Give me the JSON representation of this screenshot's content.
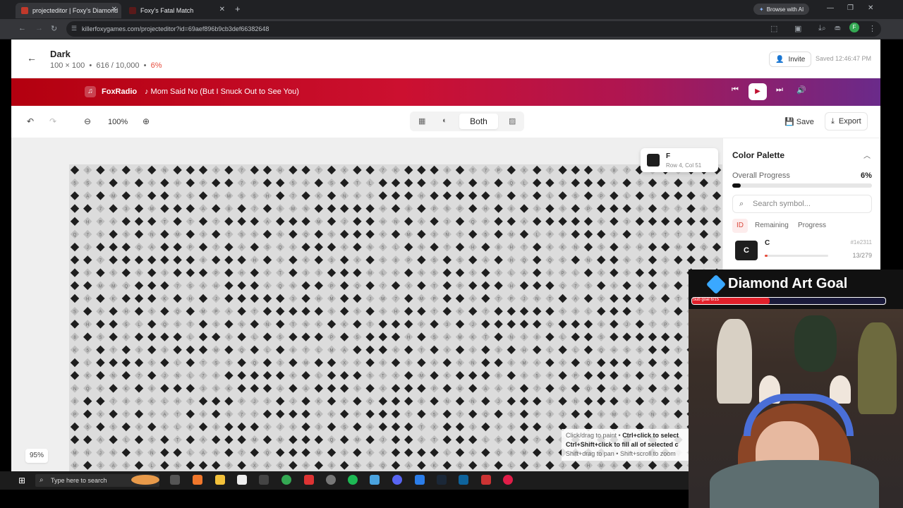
{
  "browser": {
    "tabs": [
      {
        "title": "projecteditor | Foxy's Diamond"
      },
      {
        "title": "Foxy's Fatal Match"
      }
    ],
    "ai_button": "Browse with AI",
    "url": "killerfoxygames.com/projecteditor?id=69aef896b9cb3def66382648",
    "profile_initial": "F"
  },
  "project": {
    "title": "Dark",
    "dimensions": "100 × 100",
    "separator": "•",
    "placed": "616 / 10,000",
    "percent": "6%",
    "invite": "Invite",
    "saved": "Saved 12:46:47 PM"
  },
  "radio": {
    "name": "FoxRadio",
    "song": "♪ Mom Said No (But I Snuck Out to See You)"
  },
  "toolbar": {
    "zoom": "100%",
    "view_mode": "Both",
    "save": "Save",
    "export": "Export"
  },
  "canvas": {
    "tooltip_symbol": "F",
    "tooltip_position": "Row 4, Col 51",
    "hint_line1_a": "Click/drag to paint • ",
    "hint_line1_b": "Ctrl+click to select",
    "hint_line2": "Ctrl+Shift+click to fill all of selected c",
    "hint_line3": "Shift+drag to pan • Shift+scroll to zoom",
    "zoom_badge": "95%"
  },
  "palette": {
    "title": "Color Palette",
    "progress_label": "Overall Progress",
    "progress_value": "6%",
    "progress_fraction": 0.06,
    "search_placeholder": "Search symbol...",
    "tabs": [
      "ID",
      "Remaining",
      "Progress"
    ],
    "active_tab": "ID",
    "rows": [
      {
        "symbol": "C",
        "label": "C",
        "hex": "#1e2311",
        "count": "13/279",
        "fraction": 0.047
      }
    ]
  },
  "stream": {
    "goal_title": "Diamond Art Goal",
    "goal_sub": "Sub goal 6/15",
    "goal_fraction": 0.4
  },
  "taskbar": {
    "search_placeholder": "Type here to search"
  },
  "colors": {
    "accent_red": "#e74c3c",
    "radio_start": "#b3000f",
    "radio_end": "#6a2a8a",
    "bead_dark": "#1e1e1e",
    "bead_light": "#bdbdbd"
  },
  "grid_symbols": "A3LTQ8M7KPXSNJ5H"
}
